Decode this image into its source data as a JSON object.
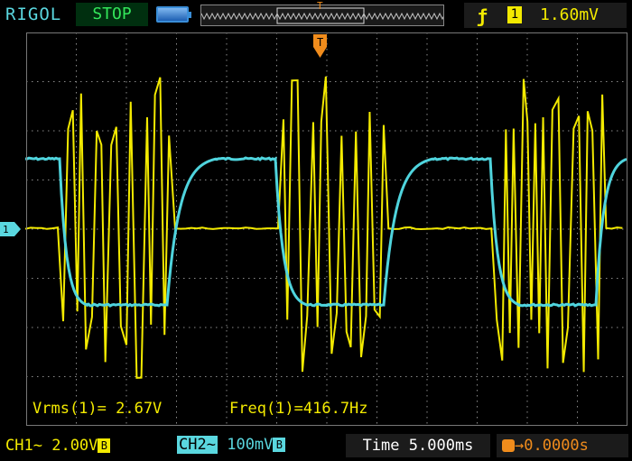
{
  "header": {
    "brand": "RIGOL",
    "run_state": "STOP",
    "trigger_marker": "T",
    "trigger_source": "1",
    "trigger_level": "1.60mV",
    "trigger_edge_icon": "rising-edge-icon"
  },
  "measurements": {
    "vrms": "Vrms(1)= 2.67V",
    "freq": "Freq(1)=416.7Hz"
  },
  "channels": {
    "ch1": {
      "label": "CH1",
      "coupling": "~",
      "scale": "2.00V",
      "bw": "B",
      "color": "#f3ea00"
    },
    "ch2": {
      "label": "CH2",
      "coupling": "~",
      "scale": "100mV",
      "bw": "B",
      "color": "#5ad7df"
    }
  },
  "timebase": {
    "label": "Time",
    "value": "5.000ms"
  },
  "trigger_offset": {
    "value": "0.0000s"
  },
  "ground_marker": "1",
  "colors": {
    "accent_orange": "#f08c1c",
    "stop_green": "#33e65a"
  }
}
